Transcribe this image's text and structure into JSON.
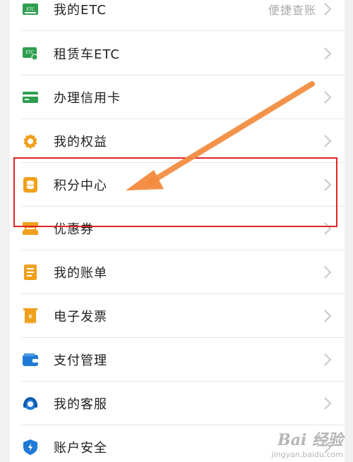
{
  "menu": {
    "items": [
      {
        "label": "我的ETC",
        "hint": "便捷查账",
        "icon": "etc-card-icon"
      },
      {
        "label": "租赁车ETC",
        "icon": "rental-etc-icon"
      },
      {
        "label": "办理信用卡",
        "icon": "credit-card-icon"
      },
      {
        "label": "我的权益",
        "icon": "badge-icon"
      },
      {
        "label": "积分中心",
        "icon": "points-icon"
      },
      {
        "label": "优惠券",
        "icon": "coupon-icon"
      },
      {
        "label": "我的账单",
        "icon": "bill-icon"
      },
      {
        "label": "电子发票",
        "icon": "invoice-icon"
      },
      {
        "label": "支付管理",
        "icon": "wallet-icon"
      },
      {
        "label": "我的客服",
        "icon": "headset-icon"
      },
      {
        "label": "账户安全",
        "icon": "shield-icon"
      }
    ]
  },
  "watermark": {
    "logo": "Bai 经验",
    "url": "jingyan.baidu.com"
  },
  "colors": {
    "green": "#2e9e4f",
    "orange": "#f0a01c",
    "blue": "#1f7ad6",
    "highlight_box": "#e02424",
    "arrow": "#f28a3c"
  }
}
